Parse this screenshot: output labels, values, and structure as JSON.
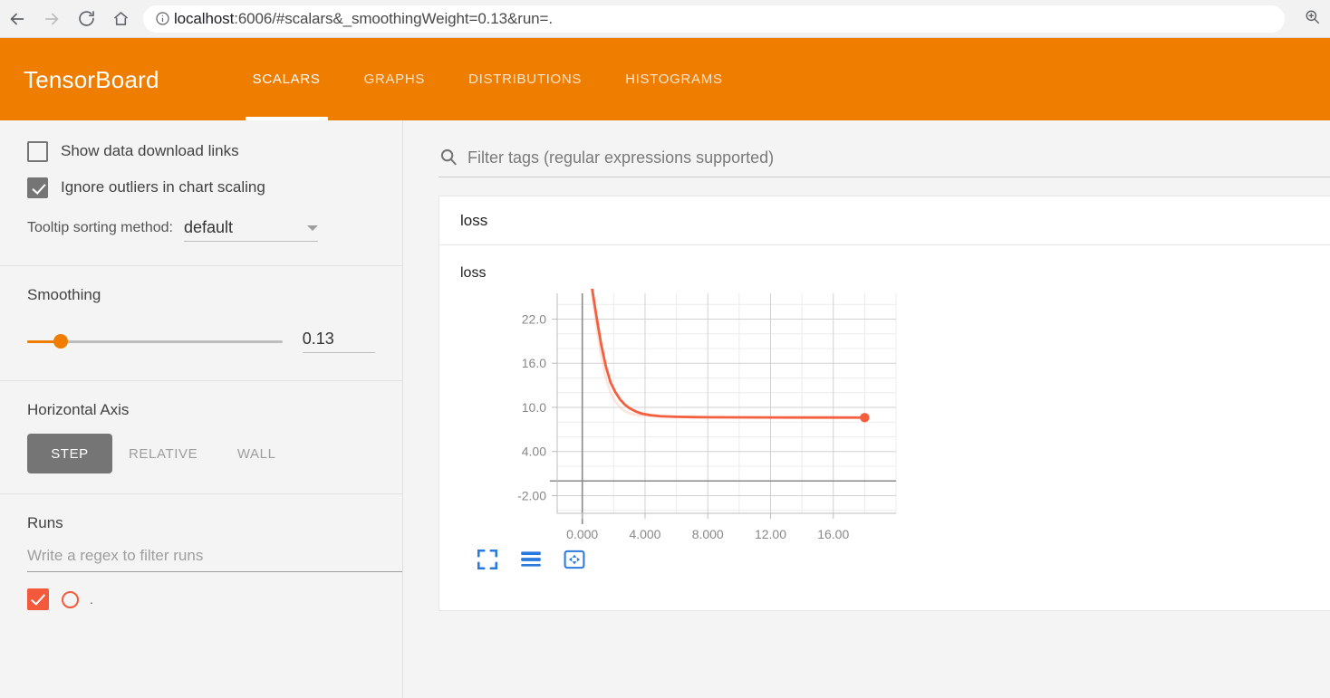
{
  "browser": {
    "back_icon": "arrow-left-icon",
    "forward_icon": "arrow-right-icon",
    "reload_icon": "reload-icon",
    "home_icon": "home-icon",
    "info_icon": "info-circle-icon",
    "zoom_icon": "zoom-in-icon",
    "url_host": "localhost",
    "url_rest": ":6006/#scalars&_smoothingWeight=0.13&run=."
  },
  "header": {
    "logo": "TensorBoard",
    "accent_color": "#ef7d00",
    "tabs": [
      {
        "label": "SCALARS",
        "active": true
      },
      {
        "label": "GRAPHS",
        "active": false
      },
      {
        "label": "DISTRIBUTIONS",
        "active": false
      },
      {
        "label": "HISTOGRAMS",
        "active": false
      }
    ]
  },
  "sidebar": {
    "checkboxes": [
      {
        "label": "Show data download links",
        "checked": false
      },
      {
        "label": "Ignore outliers in chart scaling",
        "checked": true
      }
    ],
    "tooltip": {
      "label": "Tooltip sorting method:",
      "value": "default",
      "caret_icon": "chevron-down-icon"
    },
    "smoothing": {
      "title": "Smoothing",
      "value": "0.13",
      "percent": 13
    },
    "horizontal_axis": {
      "title": "Horizontal Axis",
      "options": [
        {
          "label": "STEP",
          "active": true
        },
        {
          "label": "RELATIVE",
          "active": false
        },
        {
          "label": "WALL",
          "active": false
        }
      ]
    },
    "runs": {
      "title": "Runs",
      "filter_placeholder": "Write a regex to filter runs",
      "items": [
        {
          "name": ".",
          "checked": true,
          "color": "#f4593c"
        }
      ]
    }
  },
  "main": {
    "filter": {
      "placeholder": "Filter tags (regular expressions supported)",
      "icon": "search-icon"
    },
    "card": {
      "group_title": "loss",
      "chart_title": "loss",
      "toolbar": [
        {
          "icon": "expand-chart-icon",
          "label": "Fit domain to data"
        },
        {
          "icon": "data-table-icon",
          "label": "Toggle data table"
        },
        {
          "icon": "reset-zoom-icon",
          "label": "Reset zoom"
        }
      ]
    }
  },
  "chart_data": {
    "type": "line",
    "title": "loss",
    "xlabel": "",
    "ylabel": "",
    "grid": true,
    "legend": null,
    "xlim": [
      -1.6,
      20.0
    ],
    "ylim": [
      -4.4,
      25.5
    ],
    "xticks": [
      "0.000",
      "4.000",
      "8.000",
      "12.00",
      "16.00"
    ],
    "xtick_values": [
      0,
      4,
      8,
      12,
      16
    ],
    "yticks": [
      "22.0",
      "16.0",
      "10.0",
      "4.00",
      "-2.00"
    ],
    "ytick_values": [
      22,
      16,
      10,
      4,
      -2
    ],
    "series": [
      {
        "name": "loss (smoothed)",
        "color": "#f4603f",
        "opacity": 1.0,
        "x": [
          0.6,
          0.9,
          1.2,
          1.5,
          1.8,
          2.1,
          2.4,
          2.7,
          3.0,
          3.4,
          3.8,
          4.3,
          5.0,
          6.0,
          7.0,
          8.0,
          10.0,
          12.0,
          14.0,
          16.0,
          18.0
        ],
        "values": [
          26.5,
          22.4,
          18.6,
          15.6,
          13.4,
          12.1,
          11.1,
          10.4,
          9.9,
          9.45,
          9.15,
          8.95,
          8.8,
          8.72,
          8.68,
          8.66,
          8.64,
          8.63,
          8.62,
          8.62,
          8.61
        ]
      },
      {
        "name": "loss (raw)",
        "color": "#f9c8b4",
        "opacity": 0.45,
        "x": [
          0.6,
          0.9,
          1.2,
          1.5,
          1.8,
          2.1,
          2.4,
          2.7,
          3.0,
          3.4,
          3.8,
          4.3,
          5.0,
          6.0,
          7.0,
          8.0,
          10.0,
          12.0,
          14.0,
          16.0,
          18.0
        ],
        "values": [
          25.8,
          21.0,
          17.0,
          14.0,
          12.0,
          10.8,
          10.0,
          9.5,
          9.2,
          9.0,
          8.9,
          8.82,
          8.74,
          8.69,
          8.66,
          8.64,
          8.63,
          8.62,
          8.62,
          8.61,
          8.61
        ]
      }
    ],
    "end_marker": {
      "x": 18.0,
      "y": 8.61,
      "color": "#f4603f"
    }
  }
}
